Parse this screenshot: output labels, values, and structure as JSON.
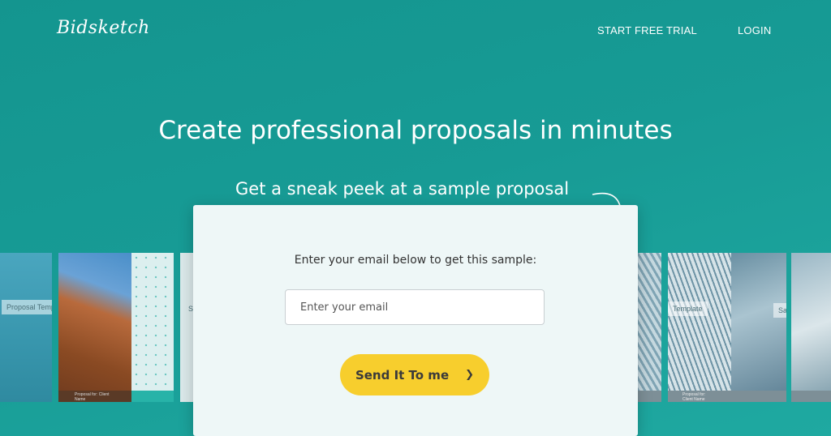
{
  "header": {
    "logo": "Bidsketch",
    "nav": {
      "trial": "START FREE TRIAL",
      "login": "LOGIN"
    }
  },
  "hero": {
    "title": "Create professional proposals in minutes",
    "subtitle": "Get a sneak peek at a sample proposal"
  },
  "templates": [
    {
      "name": "Proposal Template",
      "footer": ""
    },
    {
      "name": "",
      "footer": "Proposal for: Client Name"
    },
    {
      "name": "",
      "footer": ""
    },
    {
      "name": "S",
      "footer": ""
    },
    {
      "name": "",
      "footer": ""
    },
    {
      "name": "Template",
      "footer": "Proposal for: Client Name"
    },
    {
      "name": "Sales Propo",
      "footer": ""
    },
    {
      "name": "",
      "footer": ""
    }
  ],
  "card": {
    "prompt": "Enter your email below to get this sample:",
    "email_placeholder": "Enter your email",
    "email_value": "",
    "button_label": "Send It To me",
    "button_icon": "chevron-right-icon"
  },
  "colors": {
    "background": "#179b95",
    "card": "#eef7f7",
    "button": "#f7ce2d"
  }
}
